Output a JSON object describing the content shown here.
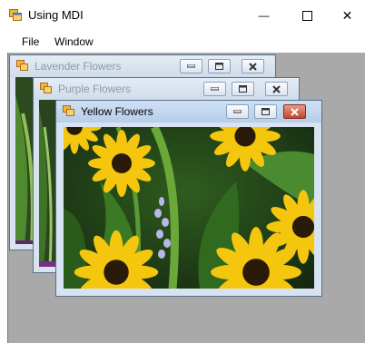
{
  "window": {
    "title": "Using MDI",
    "minimize_glyph": "—",
    "close_glyph": "✕",
    "icon": "mdi-app-icon"
  },
  "menu": {
    "file": "File",
    "window": "Window"
  },
  "children": [
    {
      "title": "Lavender Flowers",
      "state": "inactive",
      "icon": "form-icon"
    },
    {
      "title": "Purple Flowers",
      "state": "inactive",
      "icon": "form-icon"
    },
    {
      "title": "Yellow Flowers",
      "state": "active",
      "icon": "form-icon"
    }
  ],
  "colors": {
    "mdi_background": "#a9a9a9",
    "active_close": "#c4452c",
    "flower_yellow": "#f5c60e",
    "flower_center": "#2a1a08",
    "foliage": "#3a7a24"
  }
}
